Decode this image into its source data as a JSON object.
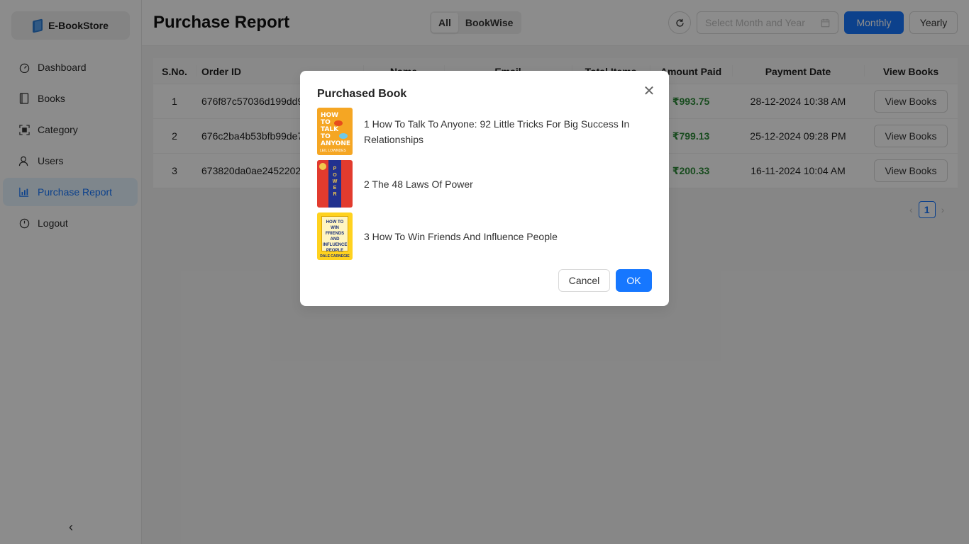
{
  "app": {
    "name": "E-BookStore"
  },
  "sidebar": {
    "items": [
      {
        "label": "Dashboard",
        "icon": "dashboard-icon"
      },
      {
        "label": "Books",
        "icon": "book-icon"
      },
      {
        "label": "Category",
        "icon": "category-icon"
      },
      {
        "label": "Users",
        "icon": "users-icon"
      },
      {
        "label": "Purchase Report",
        "icon": "chart-icon",
        "active": true
      },
      {
        "label": "Logout",
        "icon": "logout-icon"
      }
    ],
    "collapse_label": "‹"
  },
  "header": {
    "title": "Purchase Report",
    "segments": [
      "All",
      "BookWise"
    ],
    "selected_segment": "All",
    "date_placeholder": "Select Month and Year",
    "monthly_label": "Monthly",
    "yearly_label": "Yearly"
  },
  "table": {
    "columns": [
      "S.No.",
      "Order ID",
      "Name",
      "Email",
      "Total Items",
      "Amount Paid",
      "Payment Date",
      "View Books"
    ],
    "rows": [
      {
        "sno": "1",
        "order_id": "676f87c57036d199dd9",
        "amount": "₹993.75",
        "date": "28-12-2024 10:38 AM",
        "action": "View Books"
      },
      {
        "sno": "2",
        "order_id": "676c2ba4b53bfb99de7",
        "amount": "₹799.13",
        "date": "25-12-2024 09:28 PM",
        "action": "View Books"
      },
      {
        "sno": "3",
        "order_id": "673820da0ae24522029",
        "amount": "₹200.33",
        "date": "16-11-2024 10:04 AM",
        "action": "View Books"
      }
    ],
    "pagination": {
      "current": "1",
      "prev": "‹",
      "next": "›"
    }
  },
  "modal": {
    "title": "Purchased Book",
    "close_label": "✕",
    "books": [
      {
        "title": "1 How To Talk To Anyone: 92 Little Tricks For Big Success In Relationships",
        "cover_text": "HOW TO TALK TO ANYONE",
        "cover_author": "LEIL LOWNDES"
      },
      {
        "title": "2 The 48 Laws Of Power",
        "cover_text": "POWER",
        "cover_author": ""
      },
      {
        "title": "3 How To Win Friends And Influence People",
        "cover_text": "HOW TO WIN FRIENDS AND INFLUENCE PEOPLE",
        "cover_author": "DALE CARNEGIE"
      }
    ],
    "cancel_label": "Cancel",
    "ok_label": "OK"
  },
  "colors": {
    "primary": "#1677ff",
    "amount_green": "#2e8b3a",
    "mask": "rgba(0,0,0,0.45)"
  }
}
